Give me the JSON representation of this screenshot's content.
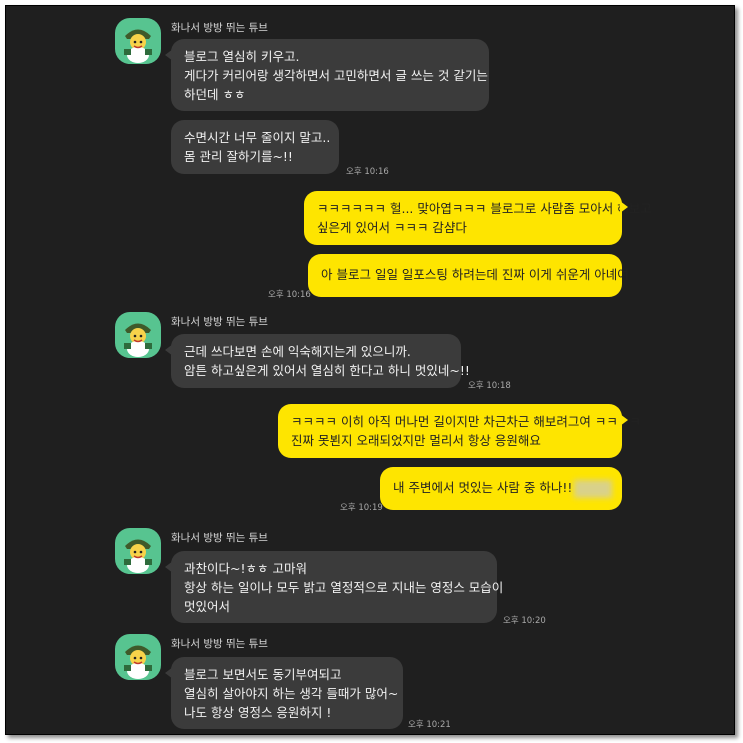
{
  "sender_name": "화나서 방방 뛰는 튜브",
  "colors": {
    "chat_background": "#1f1f1f",
    "incoming_bubble": "#3b3b3b",
    "outgoing_bubble": "#fee500",
    "avatar_background": "#57c490"
  },
  "messages": [
    {
      "direction": "incoming",
      "lines": [
        "블로그 열심히 키우고.",
        "게다가 커리어랑 생각하면서 고민하면서 글 쓰는 것 같기는",
        "하던데 ㅎㅎ"
      ]
    },
    {
      "direction": "incoming",
      "lines": [
        "수면시간 너무 줄이지 말고..",
        "몸 관리 잘하기를~!!"
      ],
      "time": "오후 10:16"
    },
    {
      "direction": "outgoing",
      "lines": [
        "ㅋㅋㅋㅋㅋㅋ 헐... 맞아엽ㅋㅋㅋ 블로그로 사람좀 모아서 해보고",
        "싶은게 있어서 ㅋㅋㅋ 감샴다"
      ]
    },
    {
      "direction": "outgoing",
      "lines": [
        "아 블로그 일일 일포스팅 하려는데 진짜 이게 쉬운게 아녜여"
      ],
      "time": "오후 10:16"
    },
    {
      "direction": "incoming",
      "lines": [
        "근데 쓰다보면 손에 익숙해지는게 있으니까.",
        "암튼 하고싶은게 있어서 열심히 한다고 하니 멋있네~!!"
      ],
      "time": "오후 10:18"
    },
    {
      "direction": "outgoing",
      "lines": [
        "ㅋㅋㅋㅋ 이히 아직 머나먼 길이지만 차근차근 해보려그여 ㅋㅋㅋㅋ",
        "진짜 못뵌지 오래되었지만 멀리서 항상 응원해요"
      ]
    },
    {
      "direction": "outgoing",
      "lines": [
        "내 주변에서 멋있는 사람 중 하나!!"
      ],
      "time": "오후 10:19"
    },
    {
      "direction": "incoming",
      "lines": [
        "과찬이다~!ㅎㅎ 고마워",
        "항상 하는 일이나 모두 밝고 열정적으로 지내는 영정스 모습이",
        "멋있어서"
      ],
      "time": "오후 10:20"
    },
    {
      "direction": "incoming",
      "lines": [
        "블로그 보면서도 동기부여되고",
        "열심히 살아야지 하는 생각 들때가 많어~",
        "나도 항상 영정스 응원하지 !"
      ],
      "time": "오후 10:21"
    }
  ]
}
